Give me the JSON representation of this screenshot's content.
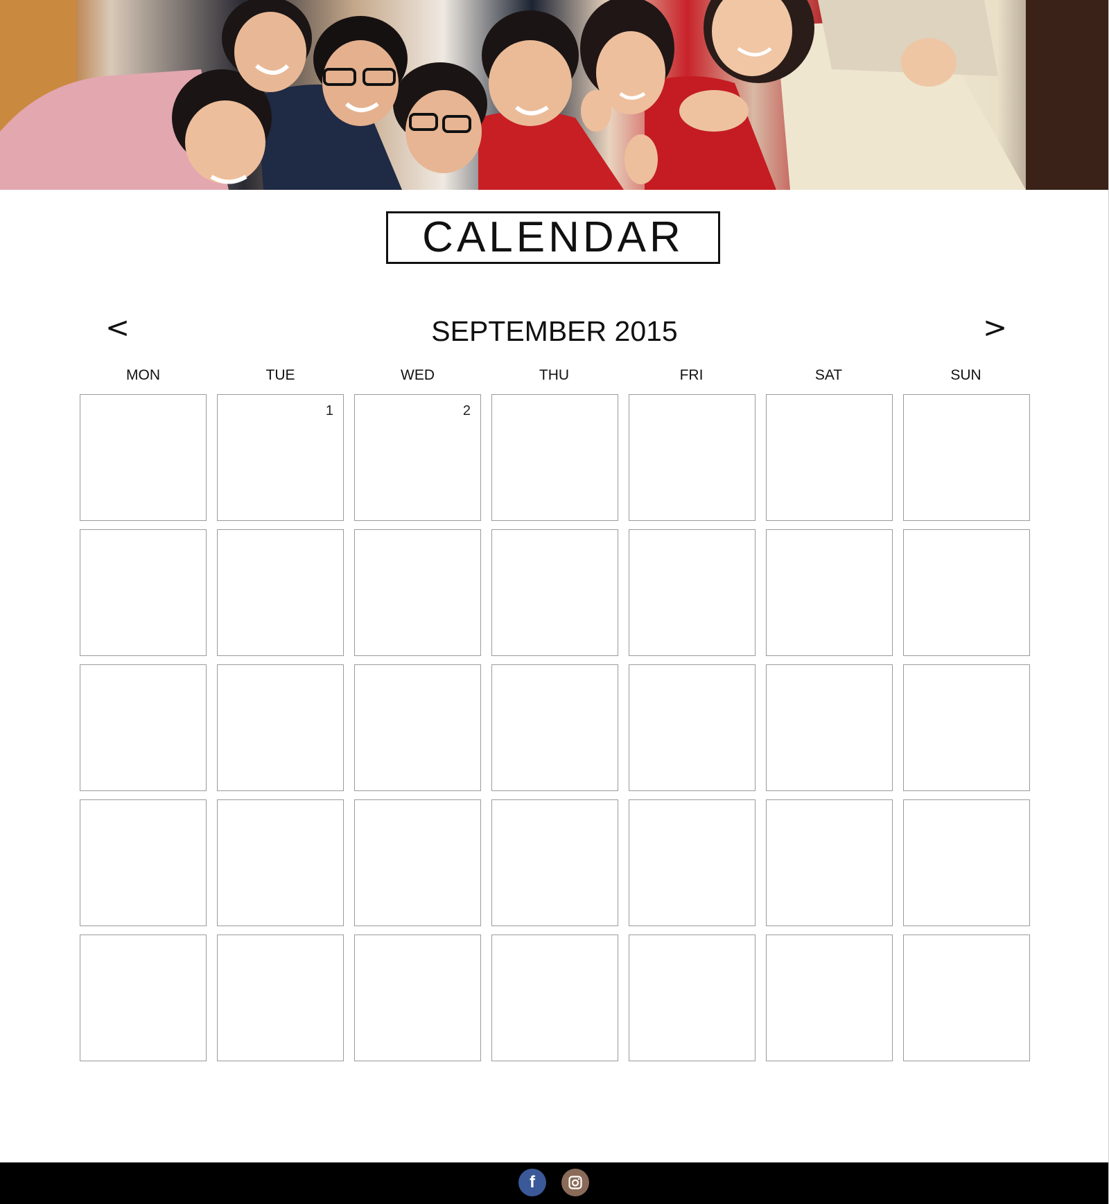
{
  "header": {
    "title": "CALENDAR"
  },
  "calendar": {
    "prev_label": "<",
    "next_label": ">",
    "month_label": "SEPTEMBER 2015",
    "weekdays": [
      "MON",
      "TUE",
      "WED",
      "THU",
      "FRI",
      "SAT",
      "SUN"
    ],
    "rows": [
      [
        "",
        "1",
        "2",
        "",
        "",
        "",
        ""
      ],
      [
        "",
        "",
        "",
        "",
        "",
        "",
        ""
      ],
      [
        "",
        "",
        "",
        "",
        "",
        "",
        ""
      ],
      [
        "",
        "",
        "",
        "",
        "",
        "",
        ""
      ],
      [
        "",
        "",
        "",
        "",
        "",
        "",
        ""
      ]
    ]
  },
  "footer": {
    "facebook_icon": "facebook-icon",
    "instagram_icon": "instagram-icon",
    "facebook_glyph": "f"
  },
  "colors": {
    "facebook": "#3b5998",
    "instagram": "#8a6a58",
    "footer_bg": "#000000",
    "cell_border": "#9a9a9a"
  }
}
